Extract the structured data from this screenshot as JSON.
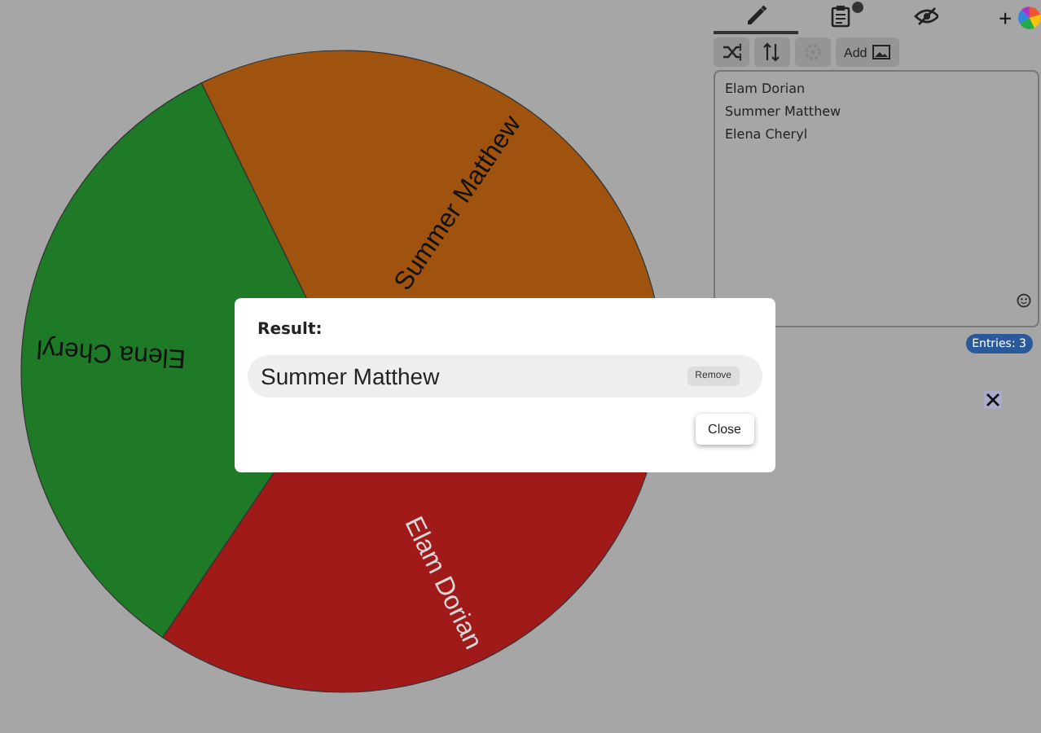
{
  "wheel": {
    "segments": [
      {
        "label": "Summer Matthew",
        "color": "#a0530f"
      },
      {
        "label": "Elam Dorian",
        "color": "#a01a1a"
      },
      {
        "label": "Elena Cheryl",
        "color": "#1e7a26"
      }
    ]
  },
  "tabs": [
    {
      "kind": "edit",
      "selected": true
    },
    {
      "kind": "results",
      "selected": false
    },
    {
      "kind": "hide",
      "selected": false
    }
  ],
  "add_wheel": "+",
  "toolbar": [
    {
      "kind": "shuffle"
    },
    {
      "kind": "sort"
    },
    {
      "kind": "settings"
    },
    {
      "kind": "add-image",
      "label": "Add"
    }
  ],
  "entries": [
    "Elam Dorian",
    "Summer Matthew",
    "Elena Cheryl"
  ],
  "entry_count": "Entries: 3",
  "dialog": {
    "title": "Result:",
    "result": "Summer Matthew",
    "remove": "Remove",
    "close": "Close"
  }
}
